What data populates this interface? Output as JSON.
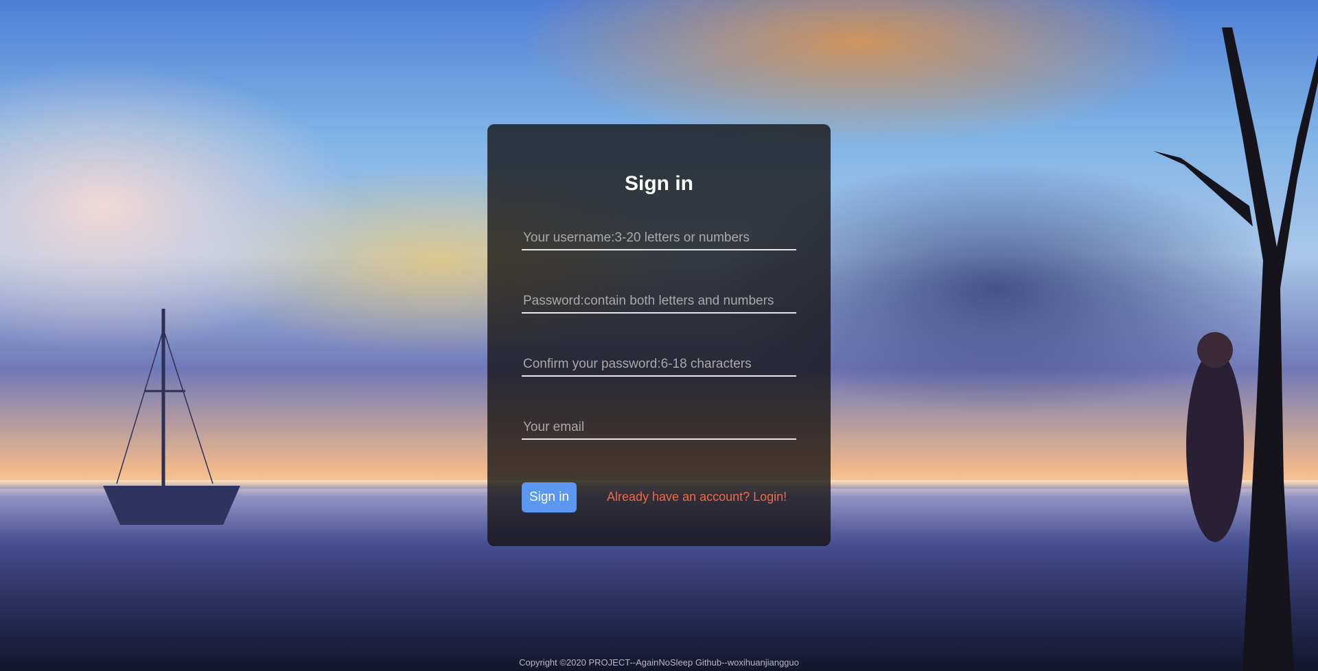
{
  "form": {
    "title": "Sign in",
    "username_placeholder": "Your username:3-20 letters or numbers",
    "password_placeholder": "Password:contain both letters and numbers",
    "confirm_placeholder": "Confirm your password:6-18 characters",
    "email_placeholder": "Your email",
    "submit_label": "Sign in",
    "login_link": "Already have an account? Login!"
  },
  "footer": {
    "copyright": "Copyright ©2020 PROJECT--AgainNoSleep Github--woxihuanjiangguo"
  },
  "colors": {
    "button": "#5b97f0",
    "link": "#f06a45",
    "panel": "rgba(20,18,18,0.78)"
  }
}
